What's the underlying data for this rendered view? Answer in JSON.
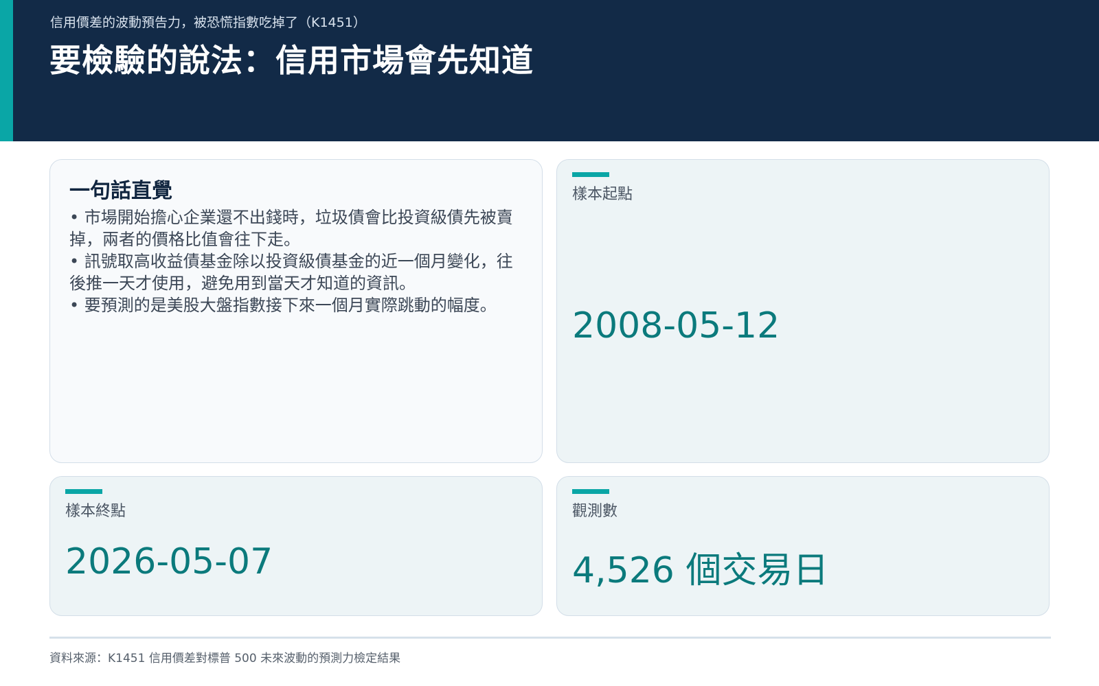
{
  "header": {
    "subtitle": "信用價差的波動預告力，被恐慌指數吃掉了（K1451）",
    "title": "要檢驗的說法：信用市場會先知道",
    "accent_color": "#0aa6a6",
    "background_color": "#122a47"
  },
  "intuition": {
    "title": "一句話直覺",
    "bullets": [
      "• 市場開始擔心企業還不出錢時，垃圾債會比投資級債先被賣掉，兩者的價格比值會往下走。",
      "• 訊號取高收益債基金除以投資級債基金的近一個月變化，往後推一天才使用，避免用到當天才知道的資訊。",
      "• 要預測的是美股大盤指數接下來一個月實際跳動的幅度。"
    ]
  },
  "kpis": {
    "start": {
      "label": "樣本起點",
      "value": "2008-05-12"
    },
    "end": {
      "label": "樣本終點",
      "value": "2026-05-07"
    },
    "observations": {
      "label": "觀測數",
      "value": "4,526 個交易日"
    },
    "value_color": "#0b7a7c"
  },
  "footer": {
    "source": "資料來源：K1451 信用價差對標普 500 未來波動的預測力檢定結果"
  }
}
